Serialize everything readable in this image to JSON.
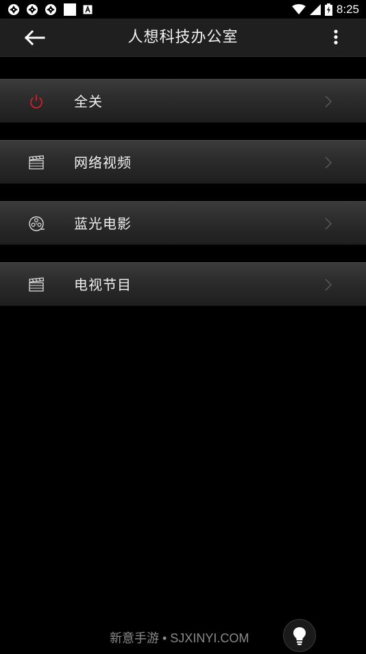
{
  "status_bar": {
    "time": "8:25",
    "left_icons": [
      "aperture-icon",
      "aperture-icon",
      "aperture-icon",
      "square-icon",
      "font-icon"
    ],
    "right_icons": [
      "wifi-icon",
      "signal-icon",
      "battery-charging-icon"
    ]
  },
  "app_bar": {
    "title": "人想科技办公室",
    "back_icon": "arrow-left-icon",
    "menu_icon": "more-vert-icon"
  },
  "menu": {
    "items": [
      {
        "label": "全关",
        "icon": "power-icon",
        "icon_color": "#d0202a"
      },
      {
        "label": "网络视频",
        "icon": "clapperboard-icon"
      },
      {
        "label": "蓝光电影",
        "icon": "film-reel-icon"
      },
      {
        "label": "电视节目",
        "icon": "clapperboard-icon"
      }
    ]
  },
  "footer": {
    "watermark": "新意手游 • SJXINYI.COM",
    "fab_icon": "lightbulb-icon"
  },
  "colors": {
    "background": "#000000",
    "app_bar": "#1f1f1f",
    "power_red": "#d0202a"
  }
}
